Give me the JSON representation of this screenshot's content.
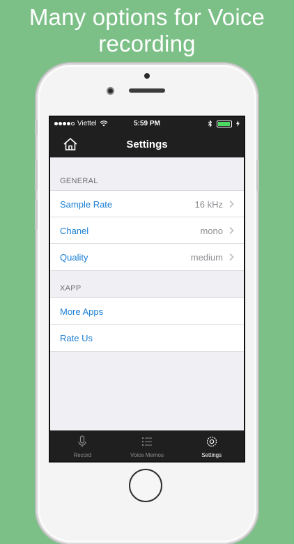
{
  "headline": {
    "line1": "Many options for Voice",
    "line2": "recording"
  },
  "status_bar": {
    "carrier": "Viettel",
    "time": "5:59 PM"
  },
  "nav": {
    "title": "Settings",
    "home_icon": "home-icon"
  },
  "sections": {
    "general": {
      "label": "GENERAL",
      "rows": [
        {
          "label": "Sample Rate",
          "value": "16 kHz"
        },
        {
          "label": "Chanel",
          "value": "mono"
        },
        {
          "label": "Quality",
          "value": "medium"
        }
      ]
    },
    "xapp": {
      "label": "XAPP",
      "rows": [
        {
          "label": "More Apps"
        },
        {
          "label": "Rate Us"
        }
      ]
    }
  },
  "tabbar": {
    "tabs": [
      {
        "label": "Record",
        "icon": "microphone-icon"
      },
      {
        "label": "Voice Memos",
        "icon": "list-icon"
      },
      {
        "label": "Settings",
        "icon": "gear-icon",
        "active": true
      }
    ]
  },
  "colors": {
    "background": "#7cc088",
    "accent": "#1b7fd4",
    "bar": "#1f1f1f"
  }
}
